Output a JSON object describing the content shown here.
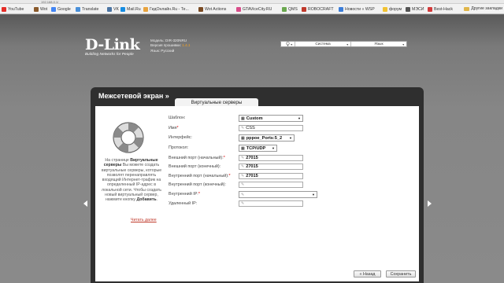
{
  "browser": {
    "url_fragment": "192.168.0.1/",
    "bookmarks": [
      {
        "label": "YouTube",
        "icon": "youtube-icon",
        "color": "#e52d27"
      },
      {
        "label": "Wot",
        "icon": "wot-icon",
        "color": "#8a5a2b"
      },
      {
        "label": "Google",
        "icon": "google-icon",
        "color": "#4285f4"
      },
      {
        "label": "Translate",
        "icon": "translate-icon",
        "color": "#4a90d9"
      },
      {
        "label": "VK",
        "icon": "vk-icon",
        "color": "#4c75a3"
      },
      {
        "label": "Mail.Ru",
        "icon": "mail-icon",
        "color": "#168de2"
      },
      {
        "label": "ГидОнлайн.Ru - Те...",
        "icon": "gid-icon",
        "color": "#e8a33d"
      },
      {
        "label": "Wot Actions",
        "icon": "wot-actions-icon",
        "color": "#7a4b23"
      },
      {
        "label": "GTAViceCity.RU",
        "icon": "gta-icon",
        "color": "#d94d8a"
      },
      {
        "label": "QMS",
        "icon": "qms-icon",
        "color": "#6aa84f"
      },
      {
        "label": "ROBOCRAFT",
        "icon": "robocraft-icon",
        "color": "#c0392b"
      },
      {
        "label": "Новости « WSP",
        "icon": "wsp-icon",
        "color": "#3b7dd8"
      },
      {
        "label": "форум",
        "icon": "forum-icon",
        "color": "#f1c232"
      },
      {
        "label": "МЭСИ",
        "icon": "mesi-icon",
        "color": "#555555"
      },
      {
        "label": "Best-Hack",
        "icon": "besthack-icon",
        "color": "#d23b3b"
      }
    ],
    "other_bookmarks": "Другие закладки"
  },
  "header": {
    "logo_main": "D-Link",
    "logo_sub": "Building Networks for People",
    "model_label": "Модель: DIR-320NRU",
    "firmware_label": "Версия прошивки:",
    "firmware_value": "1.4.1",
    "language_label": "Язык: Русский"
  },
  "topbar": {
    "icon": "lightbulb-icon",
    "system": "Система",
    "language": "Язык"
  },
  "panel": {
    "title": "Межсетевой экран »",
    "tab": "Виртуальные серверы"
  },
  "help": {
    "lead": "На странице ",
    "strong": "Виртуальные серверы",
    "body": " Вы можете создать виртуальные серверы, которые позволят перенаправлять входящий Интернет-трафик на определенный IP-адрес в локальной сети. Чтобы создать новый виртуальный сервер, нажмите кнопку ",
    "button_ref": "Добавить",
    "end": ".",
    "read_more": "Читать далее"
  },
  "form": {
    "template_label": "Шаблон:",
    "template_value": "Custom",
    "name_label": "Имя",
    "name_value": "CSS",
    "interface_label": "Интерфейс:",
    "interface_value": "pppoe_Ports:5_2",
    "protocol_label": "Протокол:",
    "protocol_value": "TCP/UDP",
    "ext_start_label": "Внешний порт (начальный):",
    "ext_start_value": "27015",
    "ext_end_label": "Внешний порт (конечный):",
    "ext_end_value": "27015",
    "int_start_label": "Внутренний порт (начальный):",
    "int_start_value": "27015",
    "int_end_label": "Внутренний порт (конечный):",
    "int_end_value": "",
    "int_ip_label": "Внутренний IP:",
    "int_ip_value": "",
    "remote_ip_label": "Удаленный IP:",
    "remote_ip_value": "",
    "required_mark": "*"
  },
  "buttons": {
    "back": "« Назад",
    "save": "Сохранить"
  },
  "colors": {
    "accent": "#f5a300",
    "required": "#dd0000",
    "link": "#c0392b"
  }
}
